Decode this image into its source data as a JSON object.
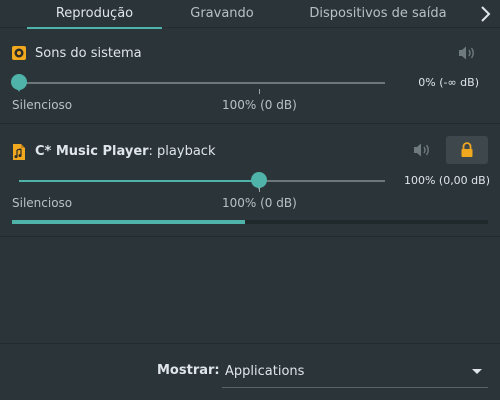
{
  "tabs": [
    {
      "label": "Reprodução",
      "active": true
    },
    {
      "label": "Gravando",
      "active": false
    },
    {
      "label": "Dispositivos de saída",
      "active": false
    }
  ],
  "streams": [
    {
      "app_name": "Sons do sistema",
      "suffix": "",
      "icon": "speaker-app-icon",
      "volume_text": "0% (-∞ dB)",
      "volume_fraction": 0.0,
      "min_label": "Silencioso",
      "ref_label": "100% (0 dB)",
      "muted_icon": "speaker-icon"
    },
    {
      "app_name": "C* Music Player",
      "suffix": ": playback",
      "icon": "music-file-icon",
      "volume_text": "100% (0,00 dB)",
      "volume_fraction": 1.0,
      "min_label": "Silencioso",
      "ref_label": "100% (0 dB)",
      "muted_icon": "speaker-icon",
      "level_fraction": 0.49
    }
  ],
  "footer": {
    "show_label": "Mostrar:",
    "show_value": "Applications"
  },
  "colors": {
    "accent": "#4fb3a9",
    "background": "#2b3539",
    "lock": "#f0a81e"
  }
}
